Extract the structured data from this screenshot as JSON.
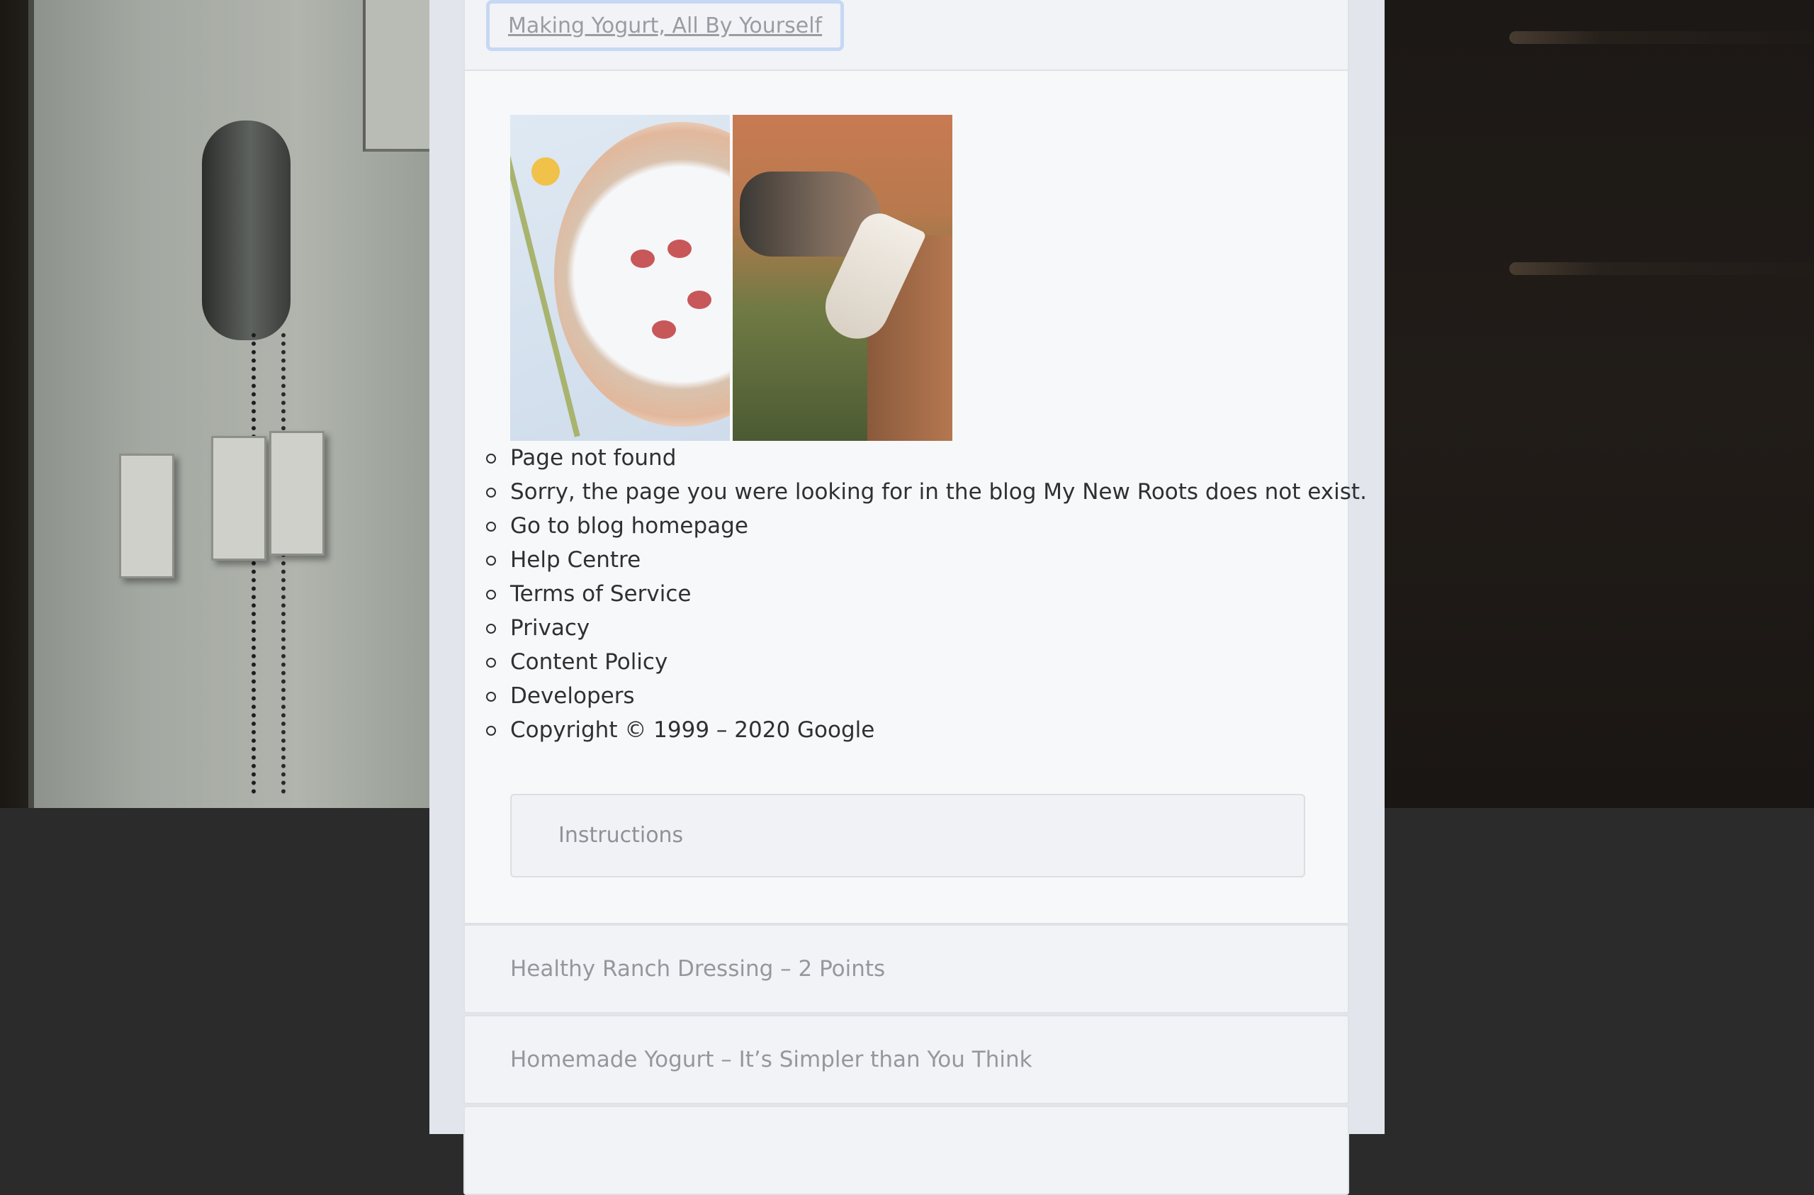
{
  "post": {
    "title_link": "Making Yogurt, All By Yourself",
    "images": [
      {
        "alt": "bowl-of-yogurt-image"
      },
      {
        "alt": "goat-image"
      }
    ],
    "error_items": [
      "Page not found",
      "Sorry, the page you were looking for in the blog My New Roots does not exist.",
      "Go to blog homepage",
      "Help Centre",
      "Terms of Service",
      "Privacy",
      "Content Policy",
      "Developers",
      "Copyright © 1999 – 2020 Google"
    ],
    "instructions_label": "Instructions"
  },
  "related": [
    {
      "label": "Healthy Ranch Dressing – 2 Points"
    },
    {
      "label": "Homemade Yogurt – It’s Simpler than You Think"
    }
  ],
  "colors": {
    "page_background": "#2b2b2b",
    "column_background": "#e2e6ec",
    "panel_background": "#f7f8fa",
    "focus_ring": "#c5d8f4",
    "text_primary": "#2e3033",
    "text_muted": "#95979c"
  }
}
